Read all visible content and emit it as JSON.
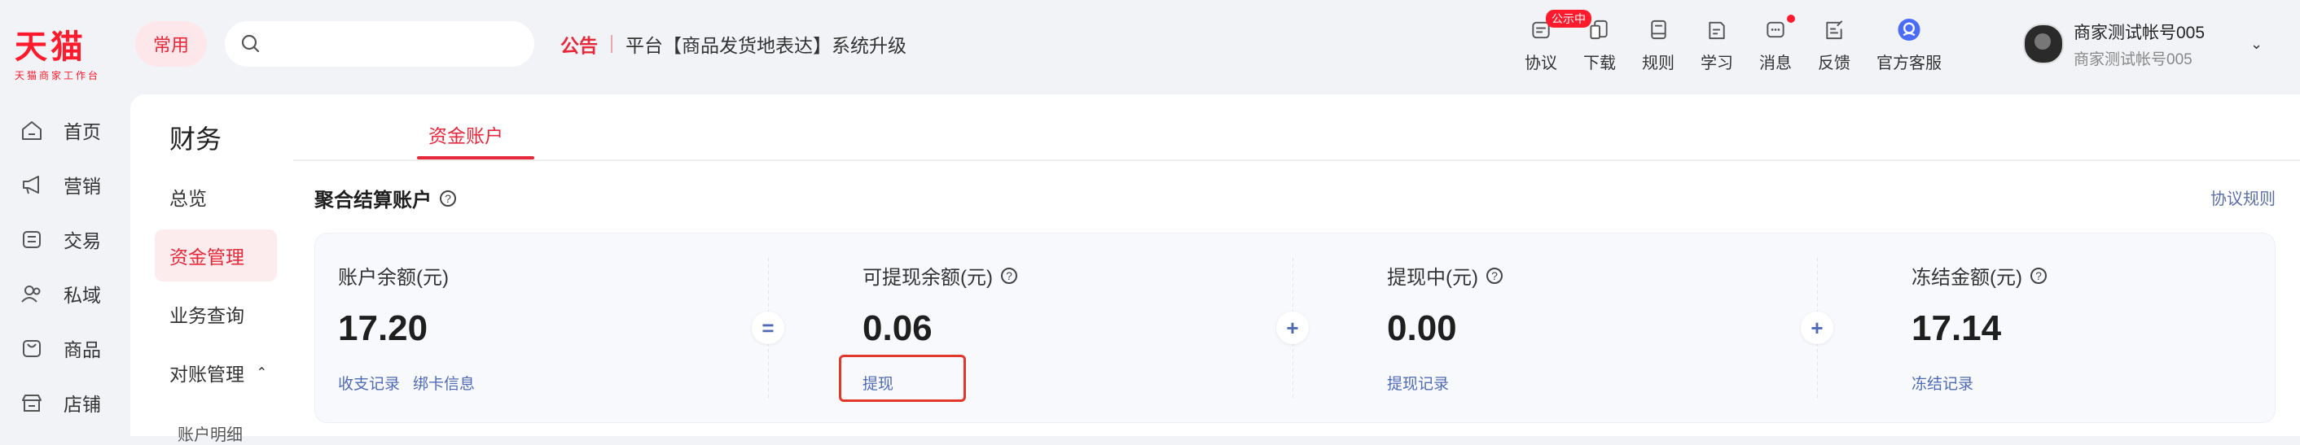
{
  "brand": {
    "logo": "天猫",
    "subtitle": "天猫商家工作台",
    "color": "#ff1a2c"
  },
  "header": {
    "common_label": "常用",
    "search": {
      "placeholder": "",
      "value": ""
    },
    "notice": {
      "tag": "公告",
      "text": "平台【商品发货地表达】系统升级"
    },
    "tools": [
      {
        "label": "协议",
        "icon": "protocol-icon",
        "badge": "公示中"
      },
      {
        "label": "下载",
        "icon": "download-icon"
      },
      {
        "label": "规则",
        "icon": "rules-icon"
      },
      {
        "label": "学习",
        "icon": "learn-icon"
      },
      {
        "label": "消息",
        "icon": "message-icon",
        "dot": true
      },
      {
        "label": "反馈",
        "icon": "feedback-icon"
      },
      {
        "label": "官方客服",
        "icon": "customer-service-icon"
      }
    ],
    "user": {
      "name": "商家测试帐号005",
      "sub": "商家测试帐号005"
    }
  },
  "leftnav": {
    "items": [
      {
        "label": "首页",
        "icon": "home-icon"
      },
      {
        "label": "营销",
        "icon": "megaphone-icon"
      },
      {
        "label": "交易",
        "icon": "trade-icon"
      },
      {
        "label": "私域",
        "icon": "users-icon"
      },
      {
        "label": "商品",
        "icon": "bag-icon"
      },
      {
        "label": "店铺",
        "icon": "store-icon"
      }
    ]
  },
  "subnav": {
    "title": "财务",
    "items": [
      {
        "label": "总览"
      },
      {
        "label": "资金管理",
        "active": true
      },
      {
        "label": "业务查询"
      },
      {
        "label": "对账管理",
        "expanded": true
      }
    ],
    "child": "账户明细"
  },
  "main": {
    "tab": "资金账户",
    "section_title": "聚合结算账户",
    "protocol_link": "协议规则",
    "columns": [
      {
        "label": "账户余额(元)",
        "value": "17.20",
        "links": [
          "收支记录",
          "绑卡信息"
        ],
        "help": false
      },
      {
        "label": "可提现余额(元)",
        "value": "0.06",
        "links": [
          "提现"
        ],
        "help": true
      },
      {
        "label": "提现中(元)",
        "value": "0.00",
        "links": [
          "提现记录"
        ],
        "help": true
      },
      {
        "label": "冻结金额(元)",
        "value": "17.14",
        "links": [
          "冻结记录"
        ],
        "help": true
      }
    ],
    "operators": [
      "=",
      "+",
      "+"
    ]
  },
  "colors": {
    "accent": "#e6283b",
    "link": "#4f6bb8",
    "highlight_box": "#e0392c"
  }
}
